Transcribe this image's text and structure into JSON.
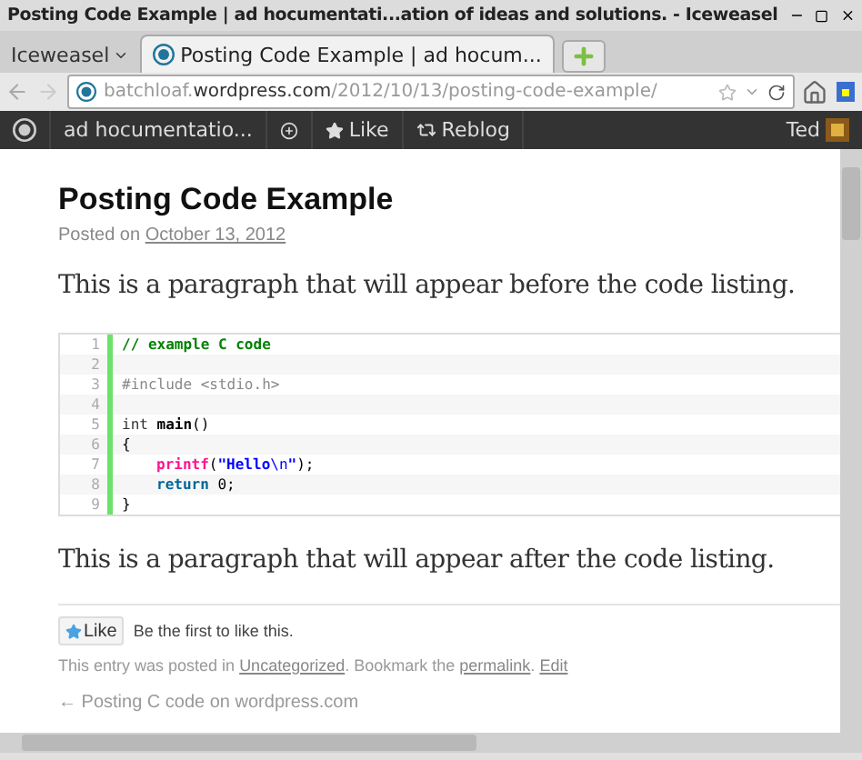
{
  "window": {
    "title": "Posting Code Example | ad hocumentati...ation of ideas and solutions. - Iceweasel"
  },
  "app_menu": {
    "label": "Iceweasel"
  },
  "tabs": [
    {
      "label": "Posting Code Example | ad hocum...",
      "selected": true
    }
  ],
  "address": {
    "value_prefix": "batchloaf.",
    "value_domain": "wordpress.com",
    "value_suffix": "/2012/10/13/posting-code-example/"
  },
  "admin_bar": {
    "site": "ad hocumentatio...",
    "like": "Like",
    "reblog": "Reblog",
    "user": "Ted"
  },
  "post": {
    "title": "Posting Code Example",
    "posted_on": "Posted on",
    "date": "October 13, 2012",
    "before": "This is a paragraph that will appear before the code listing.",
    "code_lines": [
      {
        "number": "1",
        "tokens": [
          {
            "kind": "comment",
            "text": "// example C code"
          }
        ]
      },
      {
        "number": "2"
      },
      {
        "number": "3",
        "tokens": [
          {
            "kind": "preprocessor",
            "text": "#include <stdio.h>"
          }
        ]
      },
      {
        "number": "4"
      },
      {
        "number": "5",
        "tokens": [
          {
            "kind": "keyword",
            "text": "int "
          },
          {
            "kind": "bold",
            "text": "main"
          },
          {
            "kind": "plain",
            "text": "()"
          }
        ]
      },
      {
        "number": "6",
        "tokens": [
          {
            "kind": "plain",
            "text": "{"
          }
        ]
      },
      {
        "number": "7",
        "indented": true,
        "tokens": [
          {
            "kind": "function",
            "text": "printf"
          },
          {
            "kind": "plain",
            "text": "("
          },
          {
            "kind": "string",
            "text": "\"Hello"
          },
          {
            "kind": "escape",
            "text": "\\n"
          },
          {
            "kind": "string",
            "text": "\""
          },
          {
            "kind": "plain",
            "text": ");"
          }
        ]
      },
      {
        "number": "8",
        "indented": true,
        "tokens": [
          {
            "kind": "keyword2",
            "text": "return"
          },
          {
            "kind": "plain",
            "text": " 0;"
          }
        ]
      },
      {
        "number": "9",
        "tokens": [
          {
            "kind": "plain",
            "text": "}"
          }
        ]
      }
    ],
    "after": "This is a paragraph that will appear after the code listing.",
    "like_button": "Like",
    "like_note": "Be the first to like this.",
    "entry_prefix": "This entry was posted in",
    "category": "Uncategorized",
    "bookmark": ". Bookmark the",
    "permalink": "permalink",
    "period": ".",
    "edit": "Edit",
    "previous": "← Posting C code on wordpress.com"
  }
}
